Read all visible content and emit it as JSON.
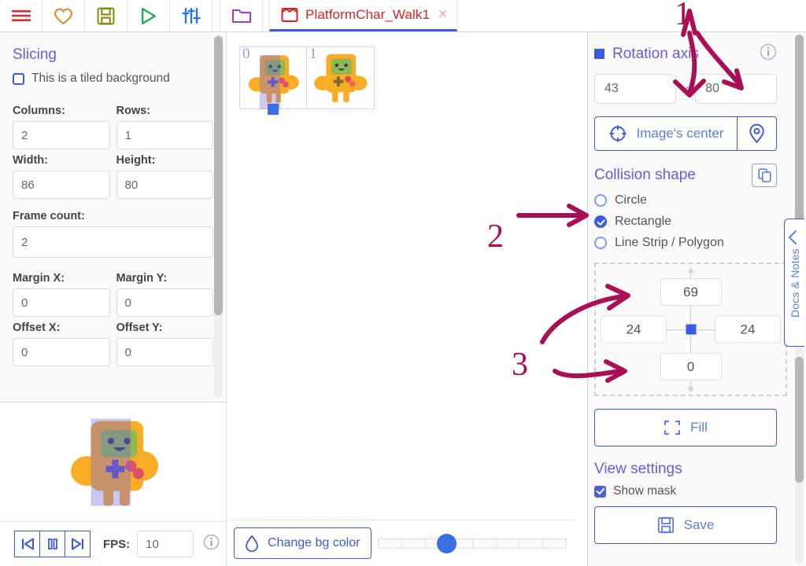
{
  "toolbar": {
    "buttons": [
      {
        "name": "menu-icon",
        "label": "Menu"
      },
      {
        "name": "favorite-icon",
        "label": "Favorite"
      },
      {
        "name": "save-icon",
        "label": "Save"
      },
      {
        "name": "play-icon",
        "label": "Play"
      },
      {
        "name": "settings-sliders-icon",
        "label": "Settings"
      },
      {
        "name": "folder-icon",
        "label": "Open folder"
      }
    ],
    "tab": {
      "title": "PlatformChar_Walk1",
      "icon": "image-file-icon",
      "close": "×"
    }
  },
  "left_panel": {
    "section_title": "Slicing",
    "tiled_checkbox": {
      "label": "This is a tiled background",
      "checked": false
    },
    "fields": [
      {
        "label": "Columns:",
        "value": "2",
        "name": "columns-input"
      },
      {
        "label": "Rows:",
        "value": "1",
        "name": "rows-input"
      },
      {
        "label": "Width:",
        "value": "86",
        "name": "width-input"
      },
      {
        "label": "Height:",
        "value": "80",
        "name": "height-input"
      }
    ],
    "frame_count": {
      "label": "Frame count:",
      "value": "2"
    },
    "margins": [
      {
        "label": "Margin X:",
        "value": "0",
        "name": "margin-x-input"
      },
      {
        "label": "Margin Y:",
        "value": "0",
        "name": "margin-y-input"
      },
      {
        "label": "Offset X:",
        "value": "0",
        "name": "offset-x-input"
      },
      {
        "label": "Offset Y:",
        "value": "0",
        "name": "offset-y-input"
      }
    ]
  },
  "preview": {
    "controls": [
      {
        "name": "first-frame-button",
        "glyph": "first-frame-icon"
      },
      {
        "name": "pause-button",
        "glyph": "pause-icon"
      },
      {
        "name": "next-frame-button",
        "glyph": "next-frame-icon"
      }
    ],
    "fps_label": "FPS:",
    "fps_value": "10",
    "info_icon": "info-icon"
  },
  "canvas": {
    "frames": [
      {
        "index": "0",
        "selected": true
      },
      {
        "index": "1",
        "selected": false
      }
    ],
    "bg_button": {
      "label": "Change bg color",
      "icon": "droplet-icon"
    },
    "zoom_slider": {
      "value": 31,
      "segments": 8
    }
  },
  "right_panel": {
    "rotation_axis": {
      "title": "Rotation axis",
      "x": "43",
      "y": "80",
      "separator": "×",
      "info_icon": "info-icon",
      "center_button": {
        "label": "Image's center",
        "icon": "crosshair-icon"
      },
      "pick_button_icon": "map-pin-icon"
    },
    "collision_shape": {
      "title": "Collision shape",
      "copy_icon": "copy-icon",
      "options": [
        {
          "label": "Circle",
          "selected": false
        },
        {
          "label": "Rectangle",
          "selected": true
        },
        {
          "label": "Line Strip / Polygon",
          "selected": false
        }
      ]
    },
    "padding_box": {
      "top": "69",
      "left": "24",
      "right": "24",
      "bottom": "0"
    },
    "fill_button": {
      "label": "Fill",
      "icon": "fill-crop-icon"
    },
    "view_settings": {
      "title": "View settings",
      "show_mask": {
        "label": "Show mask",
        "checked": true
      }
    },
    "save_button": {
      "label": "Save",
      "icon": "floppy-disk-icon"
    },
    "docs_tab": {
      "label": "Docs & Notes",
      "icon": "chevron-left-icon"
    }
  },
  "annotations": [
    {
      "number": "1",
      "target": "rotation axis fields"
    },
    {
      "number": "2",
      "target": "Rectangle radio option"
    },
    {
      "number": "3",
      "target": "padding top and bottom fields"
    }
  ],
  "colors": {
    "accent_blue": "#3b5ae0",
    "heading_purple": "#6a5bd8",
    "tab_red": "#e02020",
    "annotation_magenta": "#aa0f55"
  }
}
